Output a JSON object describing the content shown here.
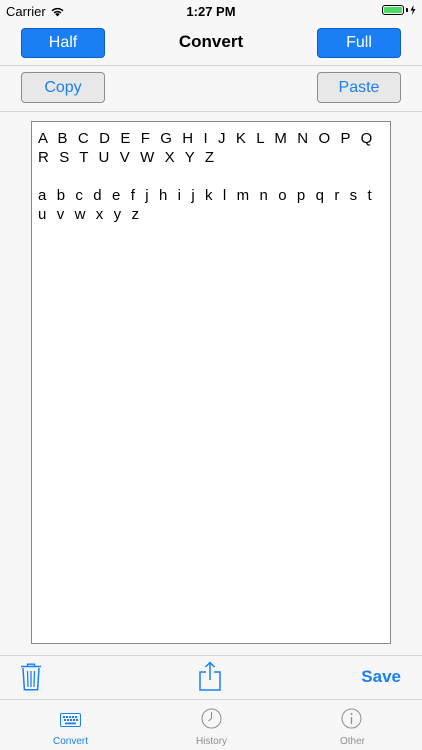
{
  "status_bar": {
    "carrier": "Carrier",
    "time": "1:27 PM",
    "battery_level": 1.0
  },
  "nav": {
    "title": "Convert",
    "left_button": "Half",
    "right_button": "Full"
  },
  "actions": {
    "copy_label": "Copy",
    "paste_label": "Paste"
  },
  "editor": {
    "text": "A B C D E F G H I J K L M N O P Q R S T U V W X Y Z\n\na b c d e f j h i j k l m n o p q r s t u v w x y z"
  },
  "toolbar": {
    "save_label": "Save",
    "icons": [
      "trash-icon",
      "share-icon"
    ]
  },
  "tabs": [
    {
      "label": "Convert",
      "icon": "keyboard-icon",
      "active": true
    },
    {
      "label": "History",
      "icon": "clock-icon",
      "active": false
    },
    {
      "label": "Other",
      "icon": "info-icon",
      "active": false
    }
  ],
  "colors": {
    "accent": "#1a7ff5",
    "inactive": "#8e8e93"
  }
}
